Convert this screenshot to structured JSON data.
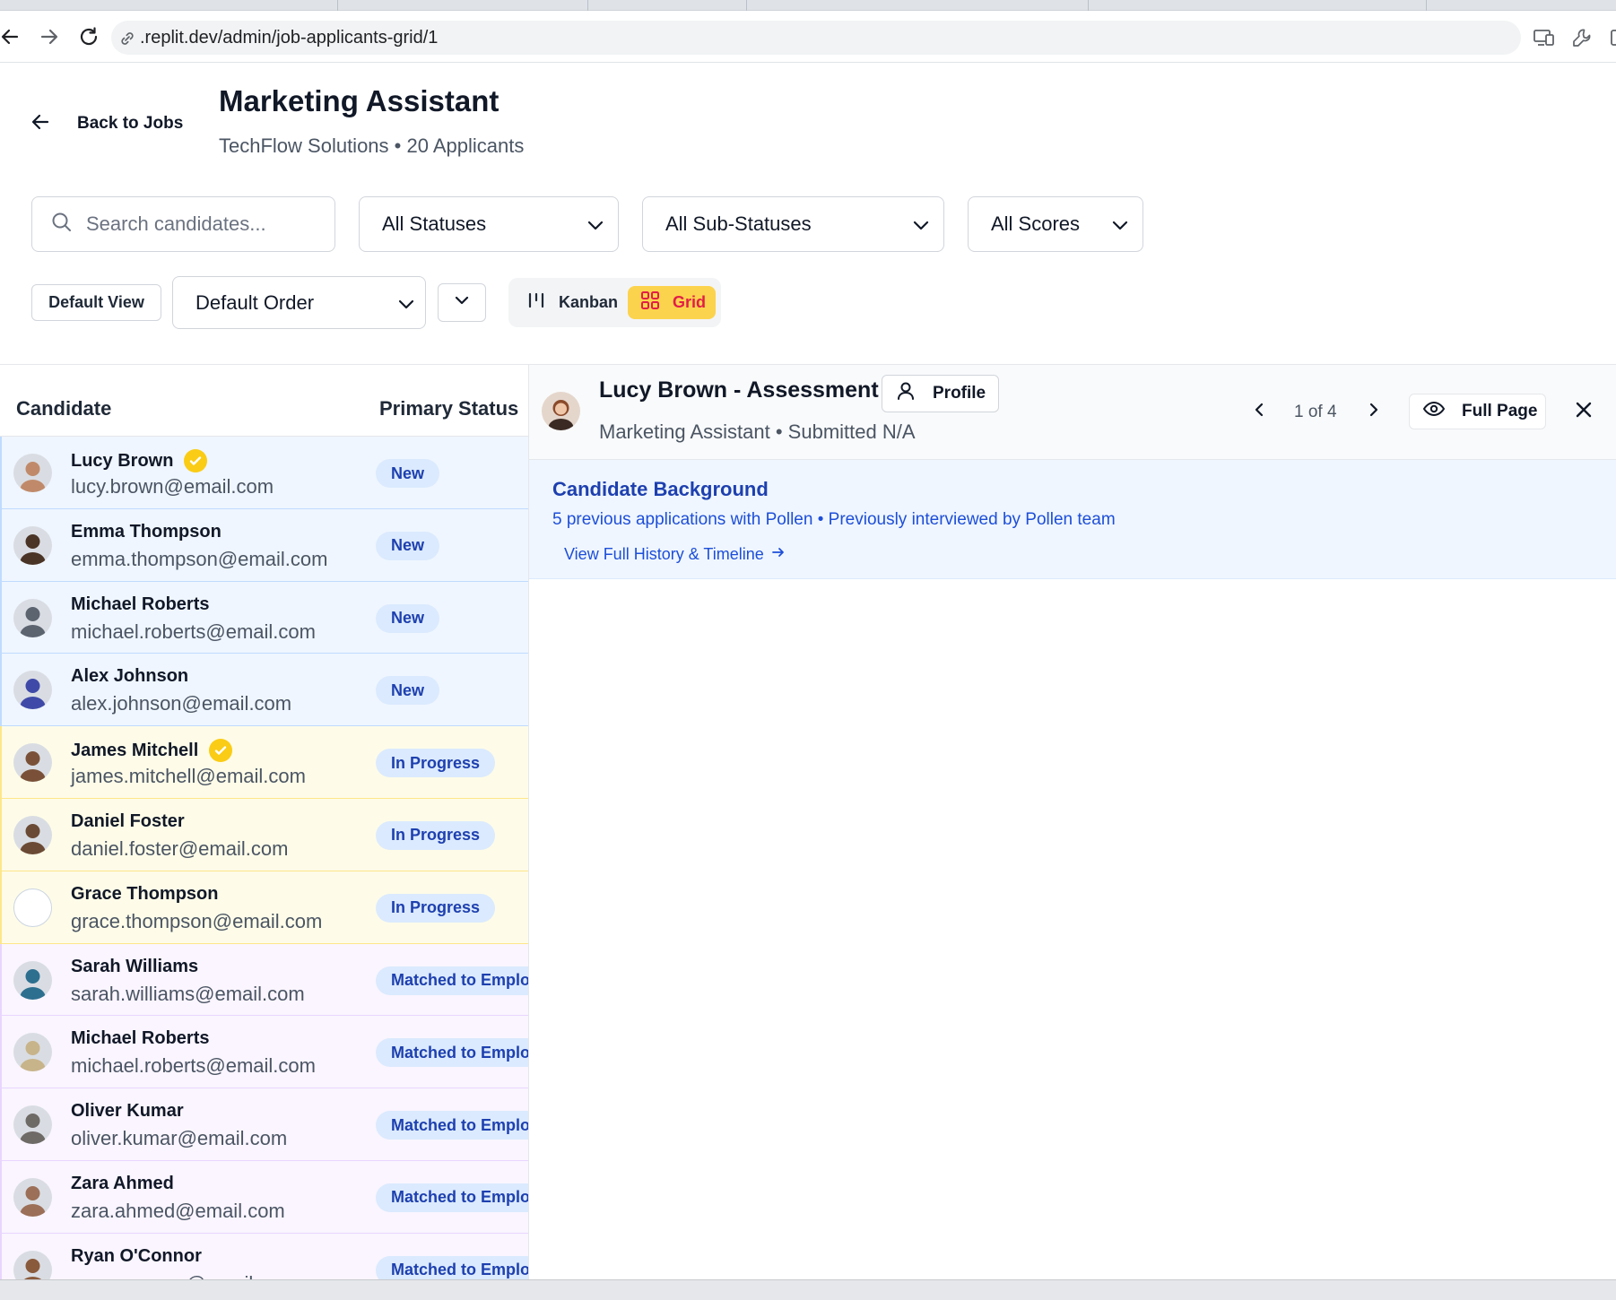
{
  "browser": {
    "url": ".replit.dev/admin/job-applicants-grid/1"
  },
  "header": {
    "back_label": "Back to Jobs",
    "title": "Marketing Assistant",
    "subtitle": "TechFlow Solutions • 20 Applicants"
  },
  "filters": {
    "search_placeholder": "Search candidates...",
    "status": "All Statuses",
    "sub_status": "All Sub-Statuses",
    "scores": "All Scores"
  },
  "view": {
    "default_view_label": "Default View",
    "order": "Default Order",
    "kanban_label": "Kanban",
    "grid_label": "Grid",
    "active": "Grid"
  },
  "table": {
    "col_candidate": "Candidate",
    "col_status": "Primary Status",
    "rows": [
      {
        "name": "Lucy Brown",
        "email": "lucy.brown@email.com",
        "status": "New",
        "verified": true,
        "tone": "blue",
        "avatar_color": "#c08a6a"
      },
      {
        "name": "Emma Thompson",
        "email": "emma.thompson@email.com",
        "status": "New",
        "verified": false,
        "tone": "blue",
        "avatar_color": "#4a3426"
      },
      {
        "name": "Michael Roberts",
        "email": "michael.roberts@email.com",
        "status": "New",
        "verified": false,
        "tone": "blue",
        "avatar_color": "#5c6470"
      },
      {
        "name": "Alex Johnson",
        "email": "alex.johnson@email.com",
        "status": "New",
        "verified": false,
        "tone": "blue",
        "avatar_color": "#3f4aa8"
      },
      {
        "name": "James Mitchell",
        "email": "james.mitchell@email.com",
        "status": "In Progress",
        "verified": true,
        "tone": "yellow",
        "avatar_color": "#7a5138"
      },
      {
        "name": "Daniel Foster",
        "email": "daniel.foster@email.com",
        "status": "In Progress",
        "verified": false,
        "tone": "yellow",
        "avatar_color": "#6b4a35"
      },
      {
        "name": "Grace Thompson",
        "email": "grace.thompson@email.com",
        "status": "In Progress",
        "verified": false,
        "tone": "yellow",
        "avatar_color": "#ffffff"
      },
      {
        "name": "Sarah Williams",
        "email": "sarah.williams@email.com",
        "status": "Matched to Emplo",
        "verified": false,
        "tone": "purple",
        "avatar_color": "#2d6f8f"
      },
      {
        "name": "Michael Roberts",
        "email": "michael.roberts@email.com",
        "status": "Matched to Emplo",
        "verified": false,
        "tone": "purple",
        "avatar_color": "#c8b48a"
      },
      {
        "name": "Oliver Kumar",
        "email": "oliver.kumar@email.com",
        "status": "Matched to Emplo",
        "verified": false,
        "tone": "purple",
        "avatar_color": "#6e6a66"
      },
      {
        "name": "Zara Ahmed",
        "email": "zara.ahmed@email.com",
        "status": "Matched to Emplo",
        "verified": false,
        "tone": "purple",
        "avatar_color": "#9c6f58"
      },
      {
        "name": "Ryan O'Connor",
        "email": "ryan.oconnor@email.com",
        "status": "Matched to Emplo",
        "verified": false,
        "tone": "purple",
        "avatar_color": "#8a5a3c"
      }
    ]
  },
  "detail": {
    "title": "Lucy Brown - Assessment",
    "subtitle": "Marketing Assistant • Submitted N/A",
    "profile_label": "Profile",
    "pager": "1 of 4",
    "full_page_label": "Full Page",
    "background": {
      "title": "Candidate Background",
      "text": "5 previous applications with Pollen • Previously interviewed by Pollen team",
      "link": "View Full History & Timeline"
    }
  },
  "colors": {
    "accent_yellow": "#fcd34d",
    "grid_text": "#e11d48",
    "badge_bg": "#dbeafe",
    "badge_text": "#1e40af"
  }
}
